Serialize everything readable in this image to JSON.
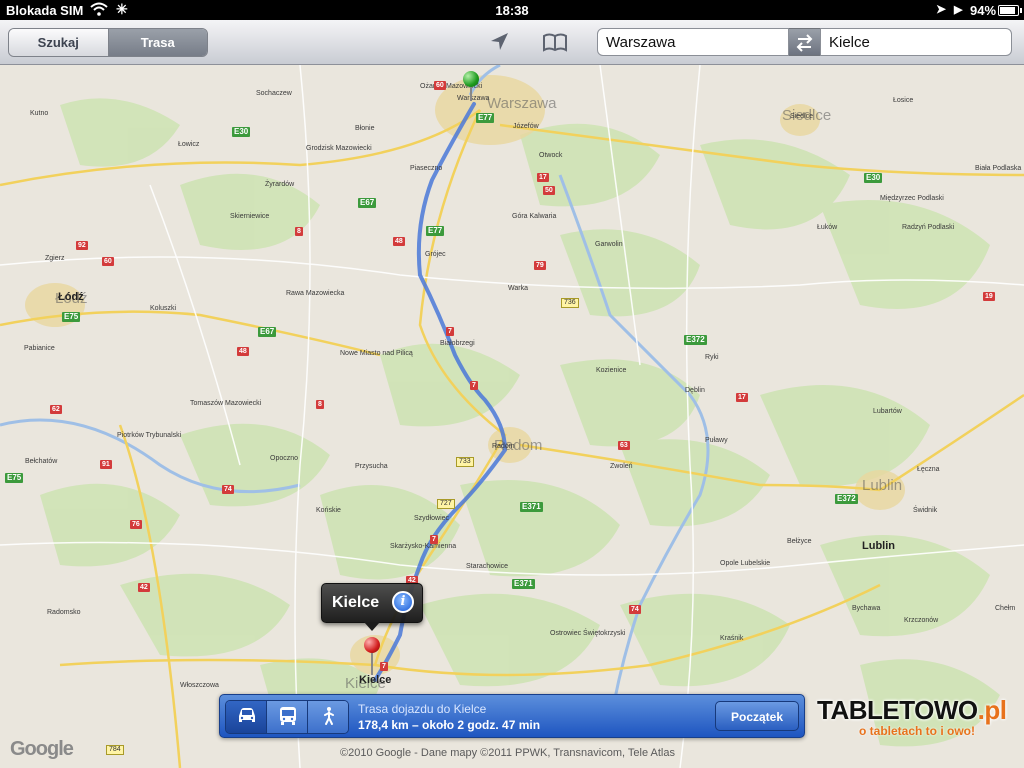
{
  "status_bar": {
    "carrier": "Blokada SIM",
    "time": "18:38",
    "battery": "94%"
  },
  "toolbar": {
    "segments": [
      "Szukaj",
      "Trasa"
    ],
    "active_segment": "Trasa",
    "from_value": "Warszawa",
    "to_value": "Kielce"
  },
  "map": {
    "big_city_labels": [
      "Warszawa",
      "Siedlce",
      "Radom",
      "Lublin",
      "Łódź",
      "Kielce"
    ],
    "city_labels": [
      "Ożarów Mazowiecki",
      "Warszawa",
      "Józefów",
      "Otwock",
      "Siedlce",
      "Łosice",
      "Biała Podlaska",
      "Międzyrzec Podlaski",
      "Sochaczew",
      "Kutno",
      "Łowicz",
      "Grodzisk Mazowiecki",
      "Błonie",
      "Piaseczno",
      "Żyrardów",
      "Skierniewice",
      "Góra Kalwaria",
      "Garwolin",
      "Łuków",
      "Radzyń Podlaski",
      "Rawa Mazowiecka",
      "Grójec",
      "Warka",
      "Ryki",
      "Dęblin",
      "Łódź",
      "Zgierz",
      "Koluszki",
      "Pabianice",
      "Nowe Miasto nad Pilicą",
      "Białobrzegi",
      "Kozienice",
      "Tomaszów Mazowiecki",
      "Puławy",
      "Lubartów",
      "Piotrków Trybunalski",
      "Bełchatów",
      "Opoczno",
      "Radom",
      "Zwoleń",
      "Łęczna",
      "Przysucha",
      "Szydłowiec",
      "Końskie",
      "Skarżysko-Kamienna",
      "Starachowice",
      "Opole Lubelskie",
      "Bełżyce",
      "Lublin",
      "Świdnik",
      "Kraśnik",
      "Ostrowiec Świętokrzyski",
      "Radomsko",
      "Kielce",
      "Bychawa",
      "Krzczonów",
      "Chełm",
      "Włoszczowa"
    ],
    "road_numbers": [
      "E30",
      "E67",
      "E77",
      "E75",
      "E371",
      "E372",
      "7",
      "8",
      "17",
      "19",
      "42",
      "48",
      "50",
      "60",
      "62",
      "63",
      "74",
      "76",
      "79",
      "91",
      "92",
      "727",
      "733",
      "736",
      "784"
    ],
    "start_pin": "Warszawa",
    "end_pin": "Kielce"
  },
  "callout": {
    "title": "Kielce",
    "info_icon": "i"
  },
  "route_panel": {
    "modes": [
      "car-icon",
      "bus-icon",
      "walk-icon"
    ],
    "active_mode": "car-icon",
    "title": "Trasa dojazdu do Kielce",
    "summary": "178,4 km – około 2 godz. 47 min",
    "start_button": "Początek"
  },
  "footer": {
    "google_logo": "Google",
    "copyright": "©2010 Google - Dane mapy ©2011 PPWK, Transnavicom, Tele Atlas"
  },
  "watermark": {
    "brand": "TABLETOWO",
    "brand_suffix": ".pl",
    "tagline": "o tabletach to i owo!"
  }
}
